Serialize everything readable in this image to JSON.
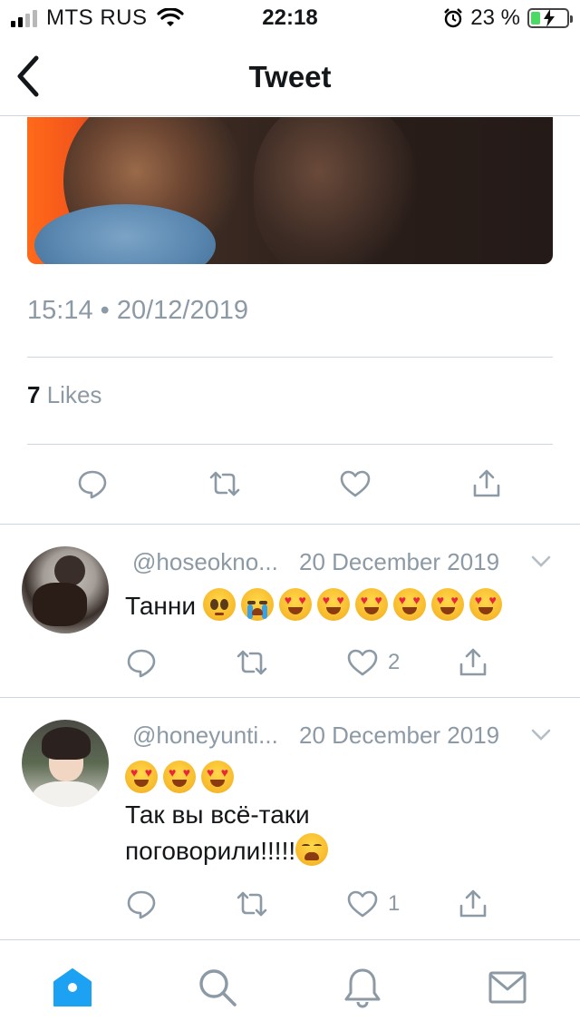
{
  "status_bar": {
    "carrier": "MTS RUS",
    "time": "22:18",
    "battery": "23 %",
    "icons": [
      "signal-icon",
      "wifi-icon",
      "alarm-icon",
      "battery-charging-icon"
    ]
  },
  "header": {
    "title": "Tweet",
    "back_icon": "chevron-left-icon"
  },
  "tweet": {
    "timestamp": "15:14 • 20/12/2019",
    "likes_count": "7",
    "likes_label": "Likes",
    "actions": [
      "reply-icon",
      "retweet-icon",
      "like-icon",
      "share-icon"
    ]
  },
  "replies": [
    {
      "handle": "@hoseokno...",
      "date": "20 December 2019",
      "text": "Танни",
      "emoji_line": [
        "pleading",
        "crying",
        "heart-eyes",
        "heart-eyes",
        "heart-eyes",
        "heart-eyes",
        "heart-eyes",
        "heart-eyes"
      ],
      "like_count": "2"
    },
    {
      "handle": "@honeyunti...",
      "date": "20 December 2019",
      "emoji_line": [
        "heart-eyes",
        "heart-eyes",
        "heart-eyes"
      ],
      "text_line1": "Так вы всё-таки",
      "text_line2": "поговорили!!!!!",
      "trailing_emoji": "weary",
      "like_count": "1"
    }
  ],
  "tab_bar": {
    "items": [
      "home-icon",
      "search-icon",
      "notifications-icon",
      "messages-icon"
    ],
    "active": "home-icon",
    "accent": "#1da1f2"
  },
  "colors": {
    "muted": "#8c9aa5",
    "divider": "#ccd6dd",
    "text": "#14171a"
  }
}
